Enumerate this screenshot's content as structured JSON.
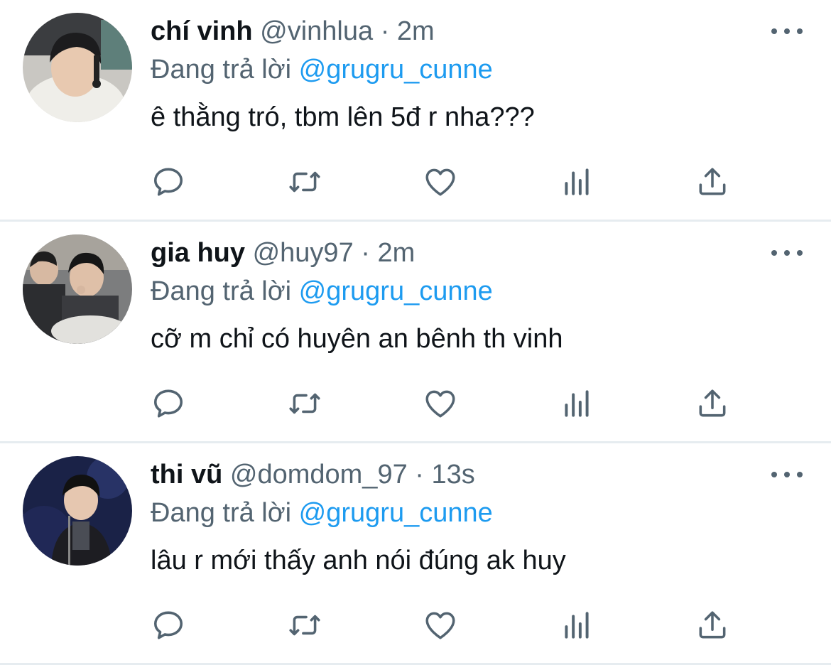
{
  "colors": {
    "text": "#0f1419",
    "secondary": "#536471",
    "link": "#1d9bf0",
    "divider": "#e6ecf0"
  },
  "icons": {
    "reply": "speech-bubble-icon",
    "retweet": "retweet-arrows-icon",
    "like": "heart-icon",
    "analytics": "bar-chart-icon",
    "share": "share-upload-icon",
    "more": "more-dots-icon"
  },
  "tweets": [
    {
      "name": "chí vinh",
      "handle": "@vinhlua",
      "separator": "·",
      "time": "2m",
      "reply_prefix": "Đang trả lời",
      "reply_to": "@grugru_cunne",
      "text": "ê thằng tró, tbm lên 5đ r nha???"
    },
    {
      "name": "gia huy",
      "handle": "@huy97",
      "separator": "·",
      "time": "2m",
      "reply_prefix": "Đang trả lời",
      "reply_to": "@grugru_cunne",
      "text": "cỡ m chỉ có huyên an bênh th vinh"
    },
    {
      "name": "thi vũ",
      "handle": "@domdom_97",
      "separator": "·",
      "time": "13s",
      "reply_prefix": "Đang trả lời",
      "reply_to": "@grugru_cunne",
      "text": "lâu r mới thấy anh nói đúng ak huy"
    }
  ]
}
